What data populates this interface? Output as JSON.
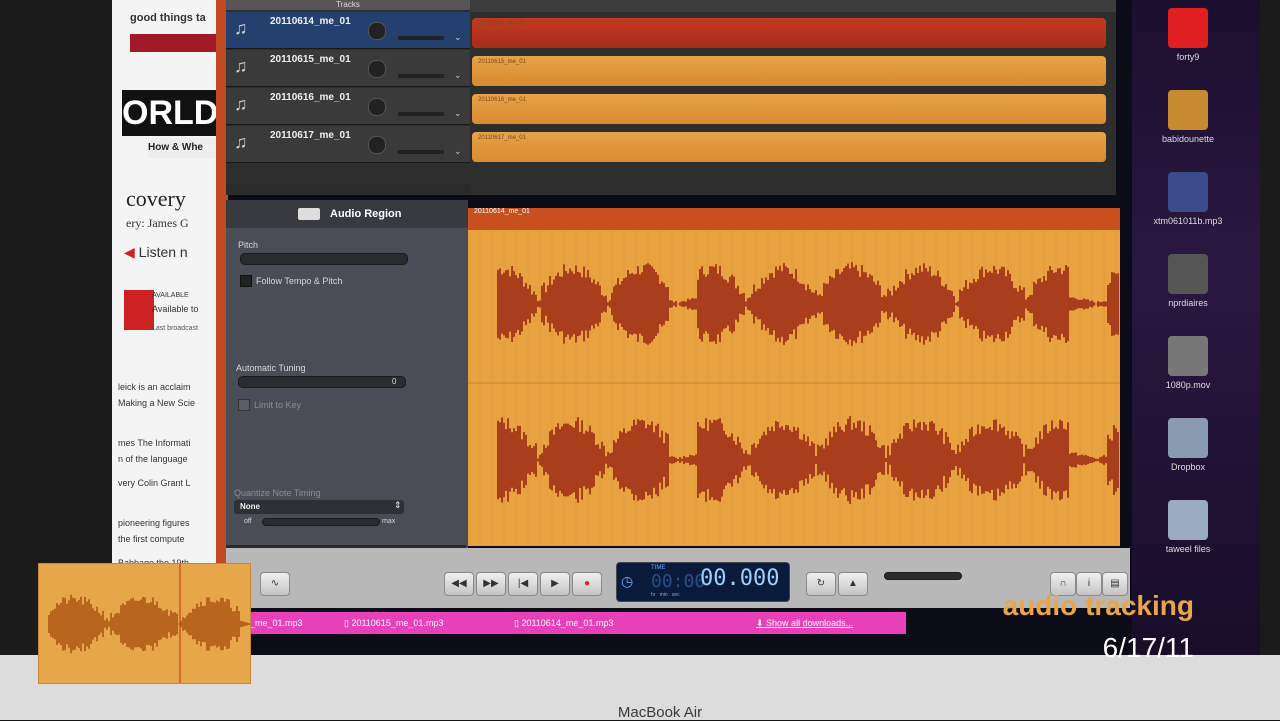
{
  "tracks_header": "Tracks",
  "tracks": [
    {
      "name": "20110614_me_01",
      "selected": true,
      "color": "#c23a22"
    },
    {
      "name": "20110615_me_01",
      "selected": false,
      "color": "#e0963a"
    },
    {
      "name": "20110616_me_01",
      "selected": false,
      "color": "#e0963a"
    },
    {
      "name": "20110617_me_01",
      "selected": false,
      "color": "#e0963a"
    }
  ],
  "region_panel": {
    "title": "Audio Region",
    "pitch_label": "Pitch",
    "follow_tempo_label": "Follow Tempo & Pitch",
    "auto_tuning_label": "Automatic Tuning",
    "auto_tuning_value": "0",
    "limit_key_label": "Limit to Key",
    "quantize_label": "Quantize Note Timing",
    "quantize_value": "None",
    "quantize_min": "off",
    "quantize_max": "max"
  },
  "editor": {
    "region_name": "20110614_me_01"
  },
  "transport": {
    "time_label": "TIME",
    "time_main": "00:00",
    "time_ms": "00.000",
    "time_units": "hr   min   sec"
  },
  "downloads": [
    "_me_01.mp3",
    "20110615_me_01.mp3",
    "20110614_me_01.mp3"
  ],
  "show_all_downloads": "Show all downloads...",
  "browser": {
    "snippet1": "good things ta",
    "snippet2": "ORLD",
    "snippet3": "How & Whe",
    "snippet4": "covery",
    "snippet5": "ery: James G",
    "snippet6": "Listen n",
    "snippet7": "AVAILABLE",
    "snippet8": "Available to",
    "snippet9": "Last broadcast",
    "snippet10": "leick is an acclaim",
    "snippet11": "Making a New Scie",
    "snippet12": "mes The Informati",
    "snippet13": "n of the language",
    "snippet14": "very Colin Grant L",
    "snippet15": "pioneering figures",
    "snippet16": "the first compute",
    "snippet17": "Babbage the 19th"
  },
  "desktop_icons": [
    {
      "label": "forty9",
      "icon": "flower-icon"
    },
    {
      "label": "babidounette",
      "icon": "usb-drive-icon"
    },
    {
      "label": "xtm061011b.mp3",
      "icon": "audio-file-icon"
    },
    {
      "label": "nprdiaires",
      "icon": "image-file-icon"
    },
    {
      "label": "1080p.mov",
      "icon": "movie-file-icon"
    },
    {
      "label": "Dropbox",
      "icon": "folder-icon"
    },
    {
      "label": "taweel files",
      "icon": "folder-icon"
    }
  ],
  "caption": "audio tracking",
  "date": "6/17/11",
  "laptop_label": "MacBook Air"
}
